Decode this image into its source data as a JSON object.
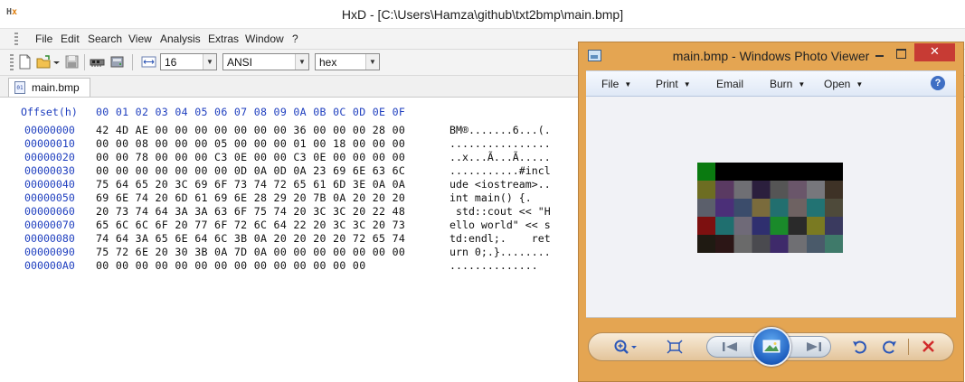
{
  "hxd": {
    "window_title": "HxD - [C:\\Users\\Hamza\\github\\txt2bmp\\main.bmp]",
    "menu": [
      "File",
      "Edit",
      "Search",
      "View",
      "Analysis",
      "Extras",
      "Window",
      "?"
    ],
    "toolbar": {
      "bytes_per_row": "16",
      "charset": "ANSI",
      "offset_base": "hex"
    },
    "tab_label": "main.bmp",
    "hex_header": {
      "offset_label": "Offset(h)",
      "columns": "00 01 02 03 04 05 06 07 08 09 0A 0B 0C 0D 0E 0F"
    },
    "rows": [
      {
        "offset": "00000000",
        "bytes": "42 4D AE 00 00 00 00 00 00 00 36 00 00 00 28 00",
        "text": "BM®.......6...(."
      },
      {
        "offset": "00000010",
        "bytes": "00 00 08 00 00 00 05 00 00 00 01 00 18 00 00 00",
        "text": "................"
      },
      {
        "offset": "00000020",
        "bytes": "00 00 78 00 00 00 C3 0E 00 00 C3 0E 00 00 00 00",
        "text": "..x...Ã...Ã....."
      },
      {
        "offset": "00000030",
        "bytes": "00 00 00 00 00 00 00 0D 0A 0D 0A 23 69 6E 63 6C",
        "text": "...........#incl"
      },
      {
        "offset": "00000040",
        "bytes": "75 64 65 20 3C 69 6F 73 74 72 65 61 6D 3E 0A 0A",
        "text": "ude <iostream>.."
      },
      {
        "offset": "00000050",
        "bytes": "69 6E 74 20 6D 61 69 6E 28 29 20 7B 0A 20 20 20",
        "text": "int main() {.   "
      },
      {
        "offset": "00000060",
        "bytes": "20 73 74 64 3A 3A 63 6F 75 74 20 3C 3C 20 22 48",
        "text": " std::cout << \"H"
      },
      {
        "offset": "00000070",
        "bytes": "65 6C 6C 6F 20 77 6F 72 6C 64 22 20 3C 3C 20 73",
        "text": "ello world\" << s"
      },
      {
        "offset": "00000080",
        "bytes": "74 64 3A 65 6E 64 6C 3B 0A 20 20 20 20 72 65 74",
        "text": "td:endl;.    ret"
      },
      {
        "offset": "00000090",
        "bytes": "75 72 6E 20 30 3B 0A 7D 0A 00 00 00 00 00 00 00",
        "text": "urn 0;.}........"
      },
      {
        "offset": "000000A0",
        "bytes": "00 00 00 00 00 00 00 00 00 00 00 00 00 00",
        "text": ".............."
      }
    ]
  },
  "photo_viewer": {
    "window_title": "main.bmp - Windows Photo Viewer",
    "close_glyph": "✕",
    "menu": [
      "File",
      "Print",
      "Email",
      "Burn",
      "Open"
    ],
    "help_glyph": "?",
    "image_pixels": [
      [
        "#0a7a10",
        "#000000",
        "#000000",
        "#000000",
        "#000000",
        "#000000",
        "#000000",
        "#000000"
      ],
      [
        "#6d6d22",
        "#5a3a62",
        "#6f6f74",
        "#2b1f3d",
        "#555555",
        "#6a566a",
        "#77777c",
        "#3e3226"
      ],
      [
        "#5b5f6b",
        "#4b2f78",
        "#3b4c6b",
        "#7a6b3c",
        "#226f6f",
        "#6e6262",
        "#227373",
        "#4e4a3a"
      ],
      [
        "#7d1010",
        "#1f6f6f",
        "#6f6a78",
        "#2f2f6f",
        "#1a8a2a",
        "#2a2a2a",
        "#7a7a22",
        "#3a3a5f"
      ],
      [
        "#1f1a12",
        "#2c1616",
        "#6a6a6a",
        "#4a4a4f",
        "#3e2a6a",
        "#6f6f73",
        "#4a5a6a",
        "#3f7a6a"
      ]
    ]
  }
}
